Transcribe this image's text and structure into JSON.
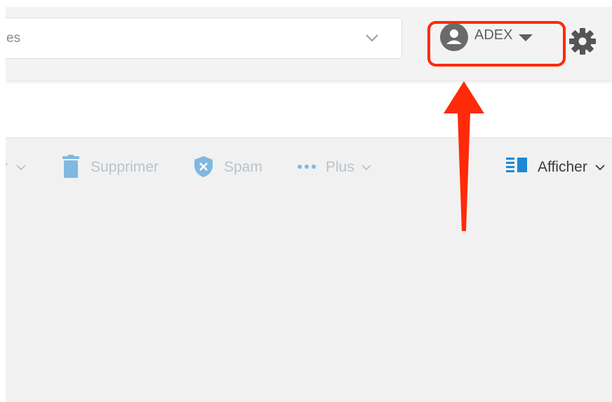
{
  "header": {
    "search_text": "es",
    "user_name": "ADEX"
  },
  "toolbar": {
    "truncated_label": "r",
    "delete_label": "Supprimer",
    "spam_label": "Spam",
    "more_label": "Plus",
    "view_label": "Afficher"
  },
  "colors": {
    "highlight": "#ff2a0a",
    "toolbar_disabled_text": "#b9c3cb",
    "toolbar_icon": "#4ea0d8",
    "view_icon": "#1f88d4"
  },
  "icons": [
    "chevron-down-icon",
    "user-avatar-icon",
    "caret-down-icon",
    "gear-icon",
    "trash-icon",
    "shield-x-icon",
    "ellipsis-icon",
    "columns-view-icon"
  ]
}
